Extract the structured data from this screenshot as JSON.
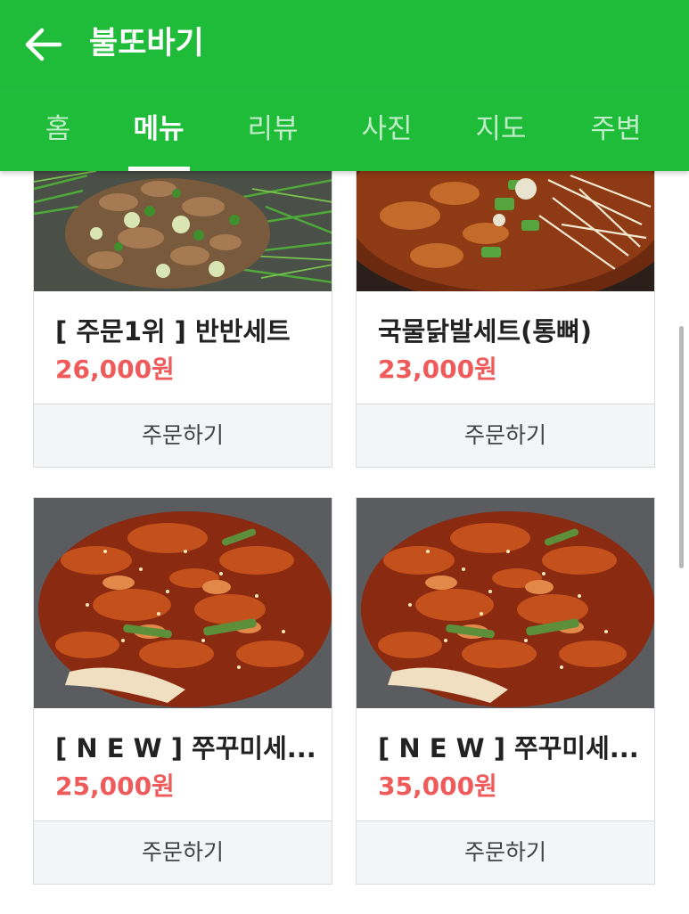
{
  "header": {
    "title": "불또바기",
    "back_icon": "arrow-left-icon",
    "background_color": "#1fbc39"
  },
  "tabs": [
    {
      "label": "홈",
      "active": false
    },
    {
      "label": "메뉴",
      "active": true
    },
    {
      "label": "리뷰",
      "active": false
    },
    {
      "label": "사진",
      "active": false
    },
    {
      "label": "지도",
      "active": false
    },
    {
      "label": "주변",
      "active": false
    }
  ],
  "menu": {
    "order_label": "주문하기",
    "price_color": "#ef5a5a",
    "items": [
      {
        "title": "[ 주문1위 ] 반반세트",
        "price": "26,000원"
      },
      {
        "title": "국물닭발세트(통뼈)",
        "price": "23,000원"
      },
      {
        "title": "[ N E W ] 쭈꾸미세...",
        "price": "25,000원"
      },
      {
        "title": "[ N E W ] 쭈꾸미세...",
        "price": "35,000원"
      }
    ]
  }
}
